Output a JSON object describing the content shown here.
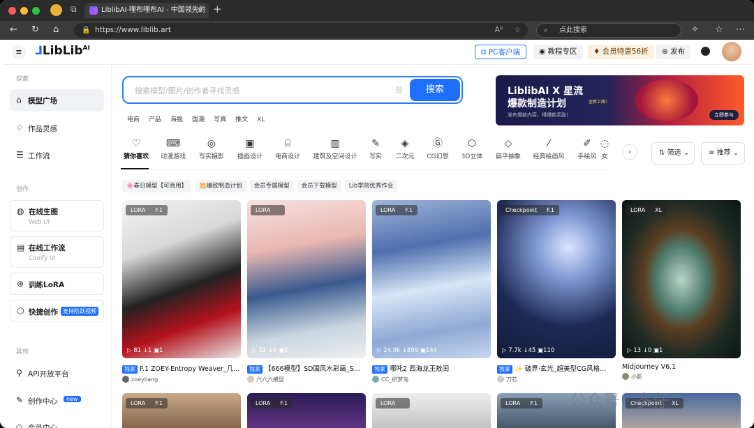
{
  "browser": {
    "tab_title": "LiblibAI-哩布哩布AI - 中国领先的",
    "url": "https://www.liblib.art",
    "search_placeholder": "点此搜索",
    "reader": "A⁰",
    "new_tab": "+",
    "tab_close": "✕"
  },
  "header": {
    "logo": "LibLib",
    "logo_suffix": "AI",
    "pc_client": "PC客户端",
    "tutorial": "教程专区",
    "vip": "会员特惠56折",
    "publish": "发布"
  },
  "sidebar": {
    "sec_explore": "探索",
    "sec_create": "创作",
    "sec_other": "其他",
    "items": [
      {
        "label": "模型广场"
      },
      {
        "label": "作品灵感"
      },
      {
        "label": "工作流"
      },
      {
        "label": "在线生图",
        "sub": "Web UI"
      },
      {
        "label": "在线工作流",
        "sub": "Comfy UI"
      },
      {
        "label": "训练LoRA"
      },
      {
        "label": "快捷创作",
        "tag": "支持阶跃视频"
      },
      {
        "label": "API开放平台"
      },
      {
        "label": "创作中心",
        "tag": "new"
      },
      {
        "label": "会员中心"
      }
    ]
  },
  "search": {
    "placeholder": "搜索模型/图片/创作者寻找灵感",
    "button": "搜索",
    "tags": [
      "电商",
      "产品",
      "海报",
      "国潮",
      "写真",
      "推文",
      "XL"
    ]
  },
  "banner": {
    "title": "LiblibAI X 星流",
    "subtitle": "爆款制造计划",
    "sub2": "发布爆款内容，得爆款奖励！",
    "cta": "立即参与",
    "new_label": "全新上线!"
  },
  "categories": [
    "猜你喜欢",
    "动漫游戏",
    "写实摄影",
    "插画设计",
    "电商设计",
    "建筑及空间设计",
    "写实",
    "二次元",
    "CG幻想",
    "3D立体",
    "扁平抽象",
    "经典绘画风",
    "手绘风",
    "女"
  ],
  "filter": {
    "filter_label": "筛选",
    "sort_label": "推荐"
  },
  "pills": [
    "🌸春日模型【可商用】",
    "💥爆款制造计划",
    "会员专属模型",
    "会员下载模型",
    "Lib学院优秀作业"
  ],
  "cards": [
    {
      "type": "LORA",
      "base": "F.1",
      "stats": "▷ 81  ↓1  ▣1",
      "exclusive": "独家",
      "title": "F.1 ZOEY-Entropy Weaver_几...",
      "author": "zoeyliang"
    },
    {
      "type": "LORA",
      "base": "",
      "stats": "▷ 32  ↓6  ▣5",
      "exclusive": "独家",
      "title": "【666模型】SD国风水彩画_S...",
      "author": "六六六模型"
    },
    {
      "type": "LORA",
      "base": "F.1",
      "stats": "▷ 24.9k  ↓899  ▣144",
      "exclusive": "独家",
      "title": "哪吒2 西海龙王敖闰",
      "author": "CC_织梦岛"
    },
    {
      "type": "Checkpoint",
      "base": "F.1",
      "stats": "▷ 7.7k  ↓45  ▣110",
      "exclusive": "独家",
      "title": "✨ 破界·玄光_超美型CG风格...",
      "author": "刀芯"
    },
    {
      "type": "LORA",
      "base": "XL",
      "stats": "▷ 13  ↓0  ▣1",
      "exclusive": "",
      "title": "Midjourney V6.1",
      "author": "小影"
    }
  ],
  "row2": [
    {
      "type": "LORA",
      "base": "F.1"
    },
    {
      "type": "LORA",
      "base": "F.1"
    },
    {
      "type": "LORA",
      "base": ""
    },
    {
      "type": "LORA",
      "base": "F.1"
    },
    {
      "type": "Checkpoint",
      "base": "XL"
    }
  ],
  "watermark": "公众号 · 多仔"
}
